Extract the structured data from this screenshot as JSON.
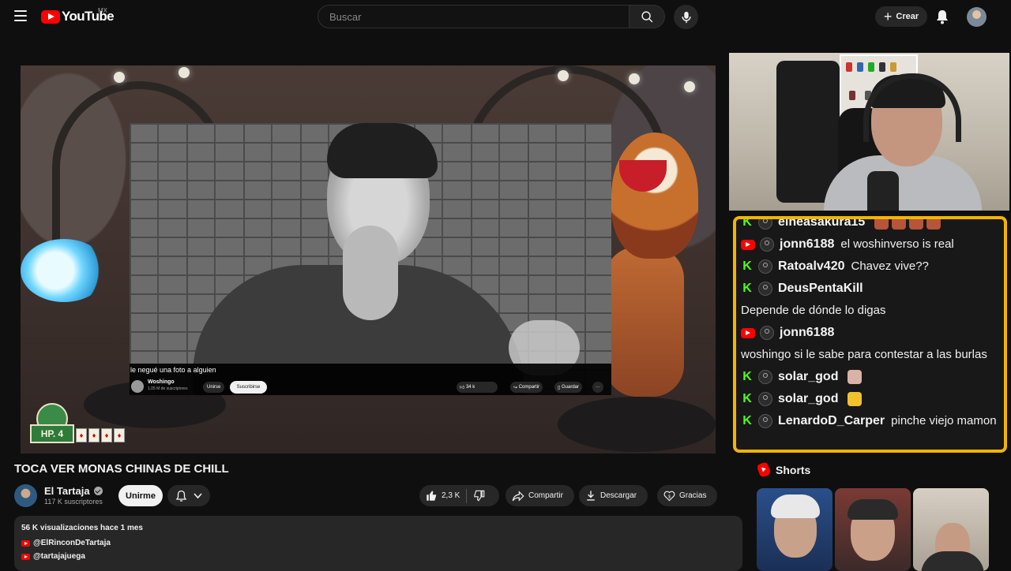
{
  "header": {
    "logo_text": "YouTube",
    "country": "MX",
    "search_placeholder": "Buscar",
    "create_label": "Crear"
  },
  "player": {
    "inner_video": {
      "title": "le negué una foto a alguien",
      "channel": "Woshingo",
      "subscribers": "1,05 M de suscriptores",
      "join_label": "Unirse",
      "subscribe_label": "Suscribirse",
      "likes": "34 k",
      "share_label": "Compartir",
      "save_label": "Guardar"
    },
    "game": {
      "hp_label": "HP. 4",
      "cards": [
        "♦",
        "♦",
        "♦",
        "♦"
      ]
    }
  },
  "chat": {
    "messages": [
      {
        "platform": "kick",
        "user": "elheasakura15",
        "text": "",
        "emotes": 4
      },
      {
        "platform": "youtube",
        "user": "jonn6188",
        "text": "el woshinverso is real"
      },
      {
        "platform": "kick",
        "user": "Ratoalv420",
        "text": "Chavez vive??"
      },
      {
        "platform": "kick",
        "user": "DeusPentaKill",
        "text": "",
        "continuation": "Depende de dónde lo digas"
      },
      {
        "platform": "youtube",
        "user": "jonn6188",
        "text": "",
        "continuation": "woshingo si le sabe para contestar a las burlas"
      },
      {
        "platform": "kick",
        "user": "solar_god",
        "text": "",
        "emotes": 1
      },
      {
        "platform": "kick",
        "user": "solar_god",
        "text": "",
        "emotes": 1
      },
      {
        "platform": "kick",
        "user": "LenardoD_Carper",
        "text": "pinche viejo mamon"
      }
    ]
  },
  "video": {
    "title": "TOCA VER MONAS CHINAS DE CHILL",
    "channel_name": "El Tartaja",
    "subscribers": "117 K suscriptores",
    "join_label": "Unirme",
    "likes": "2,3 K",
    "share_label": "Compartir",
    "download_label": "Descargar",
    "thanks_label": "Gracias"
  },
  "description": {
    "meta": "56 K visualizaciones  hace 1 mes",
    "links": [
      "@ElRinconDeTartaja",
      "@tartajajuega"
    ]
  },
  "shorts": {
    "heading": "Shorts"
  },
  "colors": {
    "accent": "#ff0000",
    "chat_border": "#f4b400",
    "kick_green": "#53fc18"
  }
}
